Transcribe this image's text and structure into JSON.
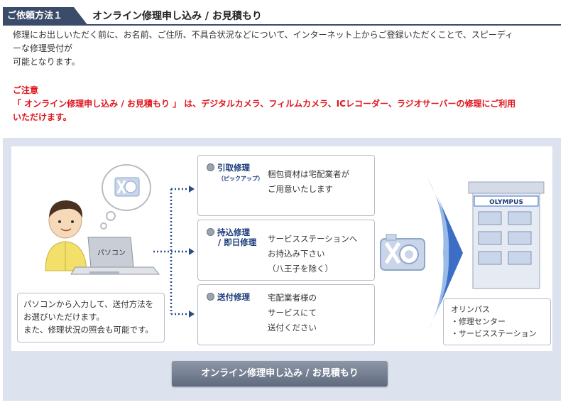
{
  "header": {
    "step_label": "ご依頼方法１",
    "title": "オンライン修理申し込み / お見積もり"
  },
  "intro": {
    "line1": "修理にお出しいただく前に、お名前、ご住所、不具合状況などについて、インターネット上からご登録いただくことで、スピーディ",
    "line2": "ーな修理受付が",
    "line3": "可能となります。"
  },
  "notice": {
    "heading": "ご注意",
    "line1": "「 オンライン修理申し込み / お見積もり 」 は、デジタルカメラ、フィルムカメラ、ICレコーダー、ラジオサーバーの修理にご利用",
    "line2": "いただけます。"
  },
  "diagram": {
    "pc_label": "パソコン",
    "pc_caption": {
      "line1": "パソコンから入力して、送付方法を",
      "line2": "お選びいただけます。",
      "line3": "また、修理状況の照会も可能です。"
    },
    "methods": [
      {
        "title": "引取修理",
        "subtitle": "（ピックアップ）",
        "line1": "梱包資材は宅配業者が",
        "line2": "ご用意いたします",
        "line3": ""
      },
      {
        "title": "持込修理",
        "subtitle": "/ 即日修理",
        "line1": "サービスステーションへ",
        "line2": "お持込み下さい",
        "line3": "（八王子を除く）"
      },
      {
        "title": "送付修理",
        "subtitle": "",
        "line1": "宅配業者様の",
        "line2": "サービスにて",
        "line3": "送付ください"
      }
    ],
    "building_sign": "OLYMPUS",
    "olympus_box": {
      "line1": "オリンパス",
      "line2": "・修理センター",
      "line3": "・サービスステーション"
    }
  },
  "cta": {
    "label": "オンライン修理申し込み / お見積もり"
  }
}
